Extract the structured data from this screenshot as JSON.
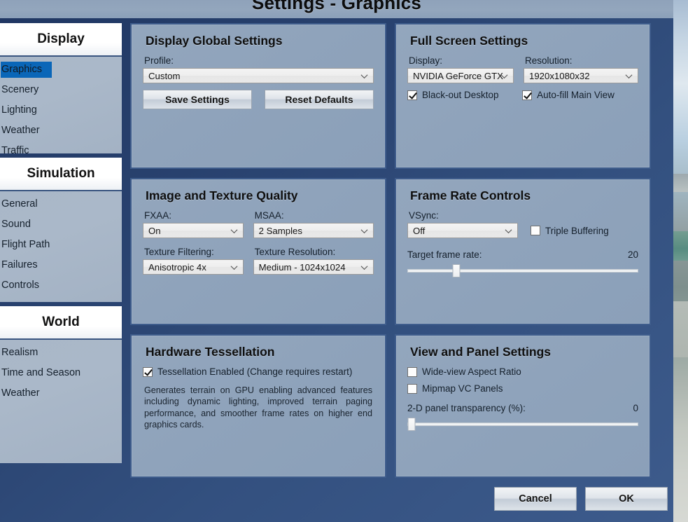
{
  "window": {
    "title": "Settings - Graphics"
  },
  "sidebar": {
    "groups": [
      {
        "header": "Display",
        "items": [
          {
            "label": "Graphics",
            "selected": true
          },
          {
            "label": "Scenery",
            "selected": false
          },
          {
            "label": "Lighting",
            "selected": false
          },
          {
            "label": "Weather",
            "selected": false
          },
          {
            "label": "Traffic",
            "selected": false
          }
        ]
      },
      {
        "header": "Simulation",
        "items": [
          {
            "label": "General",
            "selected": false
          },
          {
            "label": "Sound",
            "selected": false
          },
          {
            "label": "Flight Path",
            "selected": false
          },
          {
            "label": "Failures",
            "selected": false
          },
          {
            "label": "Controls",
            "selected": false
          }
        ]
      },
      {
        "header": "World",
        "items": [
          {
            "label": "Realism",
            "selected": false
          },
          {
            "label": "Time and Season",
            "selected": false
          },
          {
            "label": "Weather",
            "selected": false
          }
        ]
      }
    ]
  },
  "panels": {
    "display_global": {
      "title": "Display Global Settings",
      "profile_label": "Profile:",
      "profile_value": "Custom",
      "save_label": "Save Settings",
      "reset_label": "Reset Defaults"
    },
    "full_screen": {
      "title": "Full Screen Settings",
      "display_label": "Display:",
      "display_value": "NVIDIA GeForce GTX",
      "resolution_label": "Resolution:",
      "resolution_value": "1920x1080x32",
      "blackout_label": "Black-out Desktop",
      "blackout_checked": true,
      "autofill_label": "Auto-fill Main View",
      "autofill_checked": true
    },
    "image_texture": {
      "title": "Image and Texture Quality",
      "fxaa_label": "FXAA:",
      "fxaa_value": "On",
      "msaa_label": "MSAA:",
      "msaa_value": "2 Samples",
      "filtering_label": "Texture Filtering:",
      "filtering_value": "Anisotropic 4x",
      "resolution_label": "Texture Resolution:",
      "resolution_value": "Medium - 1024x1024"
    },
    "frame_rate": {
      "title": "Frame Rate Controls",
      "vsync_label": "VSync:",
      "vsync_value": "Off",
      "triple_label": "Triple Buffering",
      "triple_checked": false,
      "target_label": "Target frame rate:",
      "target_value": "20",
      "target_percent": 20
    },
    "tessellation": {
      "title": "Hardware Tessellation",
      "enabled_label": "Tessellation Enabled (Change requires restart)",
      "enabled_checked": true,
      "description": "Generates terrain on GPU enabling advanced features including dynamic lighting, improved terrain paging performance, and smoother frame rates on higher end graphics cards."
    },
    "view_panel": {
      "title": "View and Panel Settings",
      "wideview_label": "Wide-view Aspect Ratio",
      "wideview_checked": false,
      "mipmap_label": "Mipmap VC Panels",
      "mipmap_checked": false,
      "transparency_label": "2-D panel transparency (%):",
      "transparency_value": "0",
      "transparency_percent": 0
    }
  },
  "footer": {
    "cancel_label": "Cancel",
    "ok_label": "OK"
  },
  "colors": {
    "accent": "#0a66b8",
    "dialog": "#2d4470",
    "panel": "#8fa3bd",
    "panel_border": "#3f5d8c"
  }
}
